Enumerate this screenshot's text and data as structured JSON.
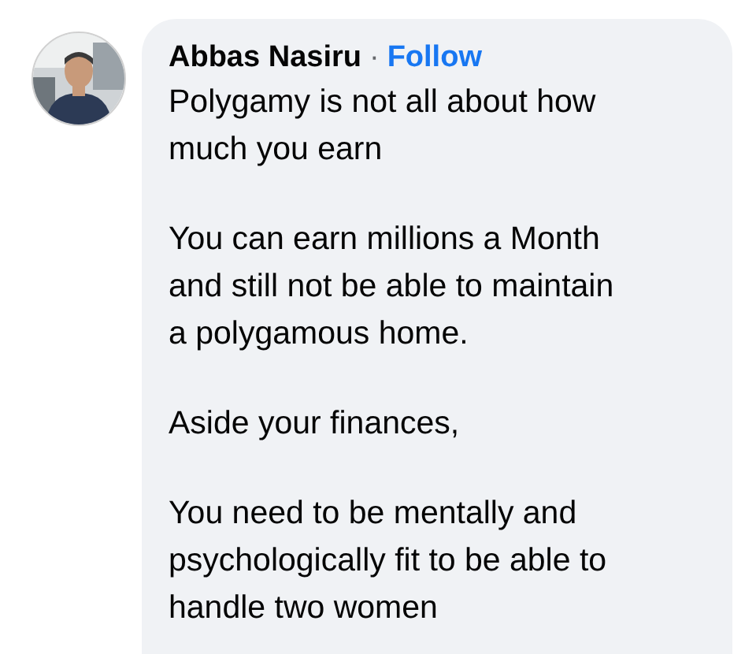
{
  "comment": {
    "author": "Abbas Nasiru",
    "separator": "·",
    "follow": "Follow",
    "paragraphs": [
      [
        "Polygamy is not all about how",
        "much you earn"
      ],
      [
        "You can earn millions a Month",
        "and still not be able to maintain",
        "a polygamous home."
      ],
      [
        "Aside your finances,"
      ],
      [
        "You need to be mentally and",
        "psychologically fit to be able to",
        "handle two women"
      ]
    ]
  }
}
